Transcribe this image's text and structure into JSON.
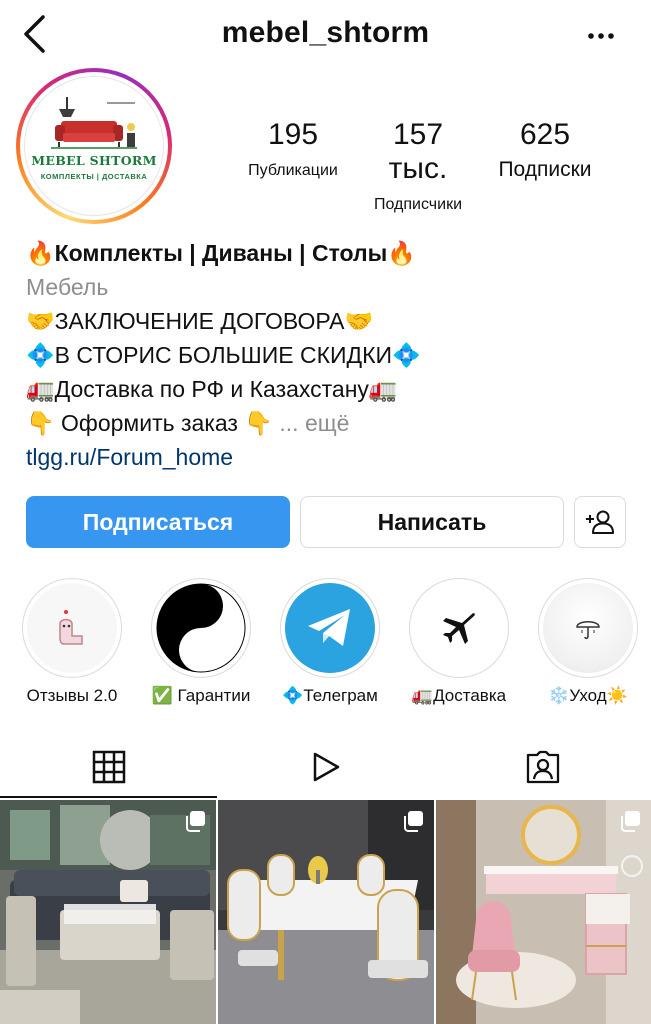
{
  "header": {
    "username": "mebel_shtorm",
    "back_icon": "chevron-left-icon",
    "more_icon": "more-dots-icon"
  },
  "avatar": {
    "logo_name": "MEBEL SHTORM",
    "logo_sub": "КОМПЛЕКТЫ | ДОСТАВКА",
    "brand_color": "#1d7a3c",
    "sofa_color": "#c8302e"
  },
  "stats": [
    {
      "value": "195",
      "label": "Публикации"
    },
    {
      "value": "157 тыс.",
      "label": "Подписчики"
    },
    {
      "value": "625",
      "label": "Подписки"
    }
  ],
  "bio": {
    "name": "🔥Комплекты | Диваны | Столы🔥",
    "category": "Мебель",
    "lines": [
      "🤝ЗАКЛЮЧЕНИЕ ДОГОВОРА🤝",
      "💠В СТОРИС БОЛЬШИЕ СКИДКИ💠",
      "🚛Доставка по РФ и Казахстану🚛",
      "👇 Оформить заказ 👇"
    ],
    "more": "... ещё",
    "link": "tlgg.ru/Forum_home"
  },
  "actions": {
    "follow_label": "Подписаться",
    "message_label": "Написать",
    "add_user_icon": "add-user-icon",
    "follow_color": "#3797f0"
  },
  "highlights": [
    {
      "label": "Отзывы 2.0",
      "icon": "ghost-sticker-icon"
    },
    {
      "label": "✅ Гарантии",
      "icon": "yin-yang-icon"
    },
    {
      "label": "💠Телеграм",
      "icon": "telegram-icon"
    },
    {
      "label": "🚛Доставка",
      "icon": "airplane-icon"
    },
    {
      "label": "❄️Уход☀️",
      "icon": "umbrella-icon"
    }
  ],
  "tabs": [
    {
      "icon": "grid-icon",
      "active": true
    },
    {
      "icon": "reels-play-icon",
      "active": false
    },
    {
      "icon": "tagged-user-icon",
      "active": false
    }
  ],
  "posts": [
    {
      "subject": "outdoor rattan sofa set",
      "multi": true
    },
    {
      "subject": "marble dining table with chairs",
      "multi": true
    },
    {
      "subject": "pink vanity table with chair",
      "multi": true
    }
  ]
}
